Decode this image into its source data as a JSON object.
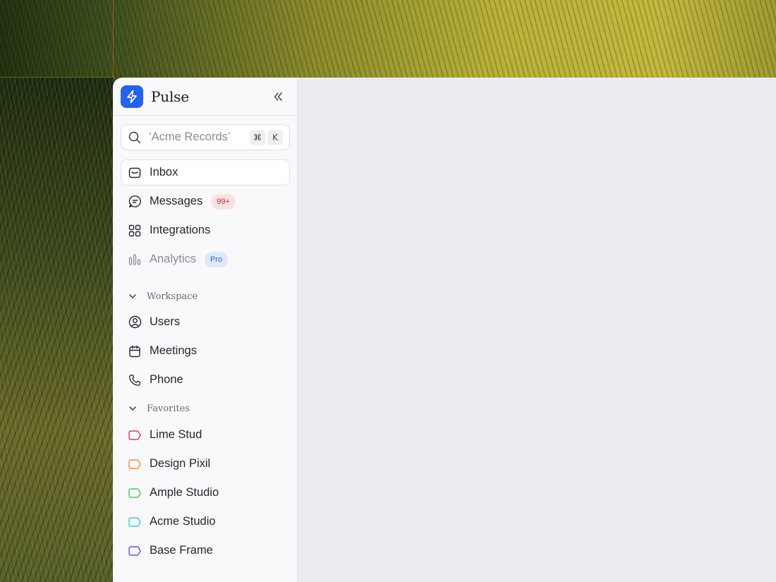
{
  "app": {
    "name": "Pulse"
  },
  "search": {
    "placeholder": "‘Acme Records’",
    "shortcut_keys": [
      "⌘",
      "K"
    ]
  },
  "nav": [
    {
      "label": "Inbox",
      "icon": "inbox-icon",
      "active": true
    },
    {
      "label": "Messages",
      "icon": "chat-icon",
      "badge": "99+"
    },
    {
      "label": "Integrations",
      "icon": "grid-icon"
    },
    {
      "label": "Analytics",
      "icon": "bar-chart-icon",
      "badge": "Pro",
      "muted": true
    }
  ],
  "workspace": {
    "title": "Workspace",
    "items": [
      {
        "label": "Users",
        "icon": "user-circle-icon"
      },
      {
        "label": "Meetings",
        "icon": "calendar-icon"
      },
      {
        "label": "Phone",
        "icon": "phone-icon"
      }
    ]
  },
  "favorites": {
    "title": "Favorites",
    "items": [
      {
        "label": "Lime Stud",
        "color": "#e5364d"
      },
      {
        "label": "Design Pixil",
        "color": "#ef8a3c"
      },
      {
        "label": "Ample Studio",
        "color": "#46c66b"
      },
      {
        "label": "Acme Studio",
        "color": "#3cc7c9"
      },
      {
        "label": "Base Frame",
        "color": "#5b57d9"
      }
    ]
  },
  "colors": {
    "accent": "#2463eb",
    "badge_red": "#d0233a",
    "badge_blue": "#3b67d4"
  }
}
